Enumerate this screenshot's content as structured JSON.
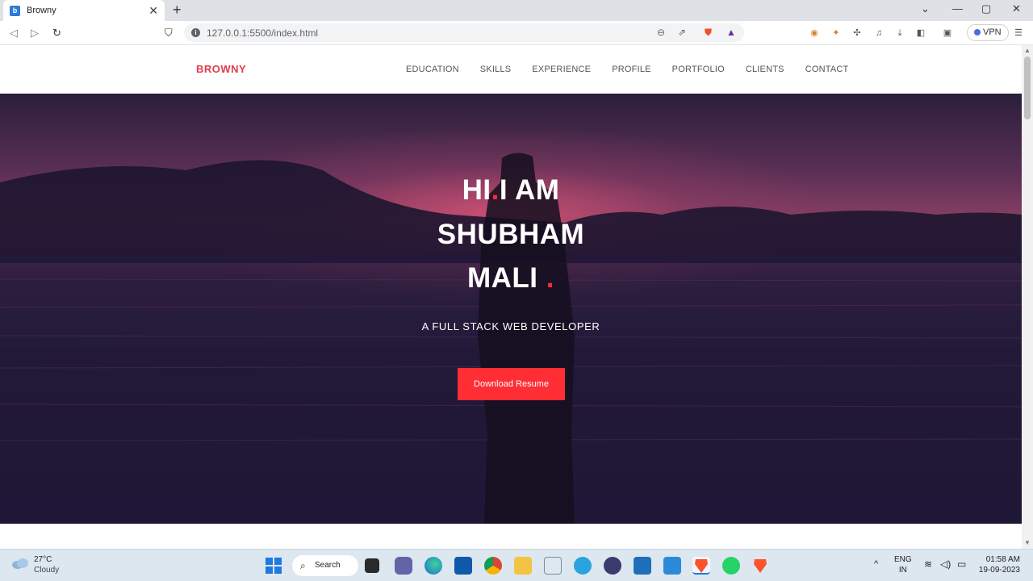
{
  "browser": {
    "tab_title": "Browny",
    "favicon_glyph": "b",
    "new_tab": "+",
    "url": "127.0.0.1:5500/index.html",
    "vpn_label": "VPN"
  },
  "site": {
    "logo": "BROWNY",
    "nav": [
      "EDUCATION",
      "SKILLS",
      "EXPERIENCE",
      "PROFILE",
      "PORTFOLIO",
      "CLIENTS",
      "CONTACT"
    ],
    "hero": {
      "line1_a": "HI",
      "line1_dot": ".",
      "line1_b": "I AM",
      "line2": "SHUBHAM",
      "line3": "MALI",
      "line3_dot": ".",
      "subtitle": "A FULL STACK WEB DEVELOPER",
      "cta": "Download Resume"
    },
    "accent_color": "#ff2e35",
    "logo_color": "#e03a4e"
  },
  "taskbar": {
    "temperature": "27°C",
    "condition": "Cloudy",
    "search_label": "Search",
    "lang_top": "ENG",
    "lang_bottom": "IN",
    "time": "01:58 AM",
    "date": "19-09-2023"
  }
}
